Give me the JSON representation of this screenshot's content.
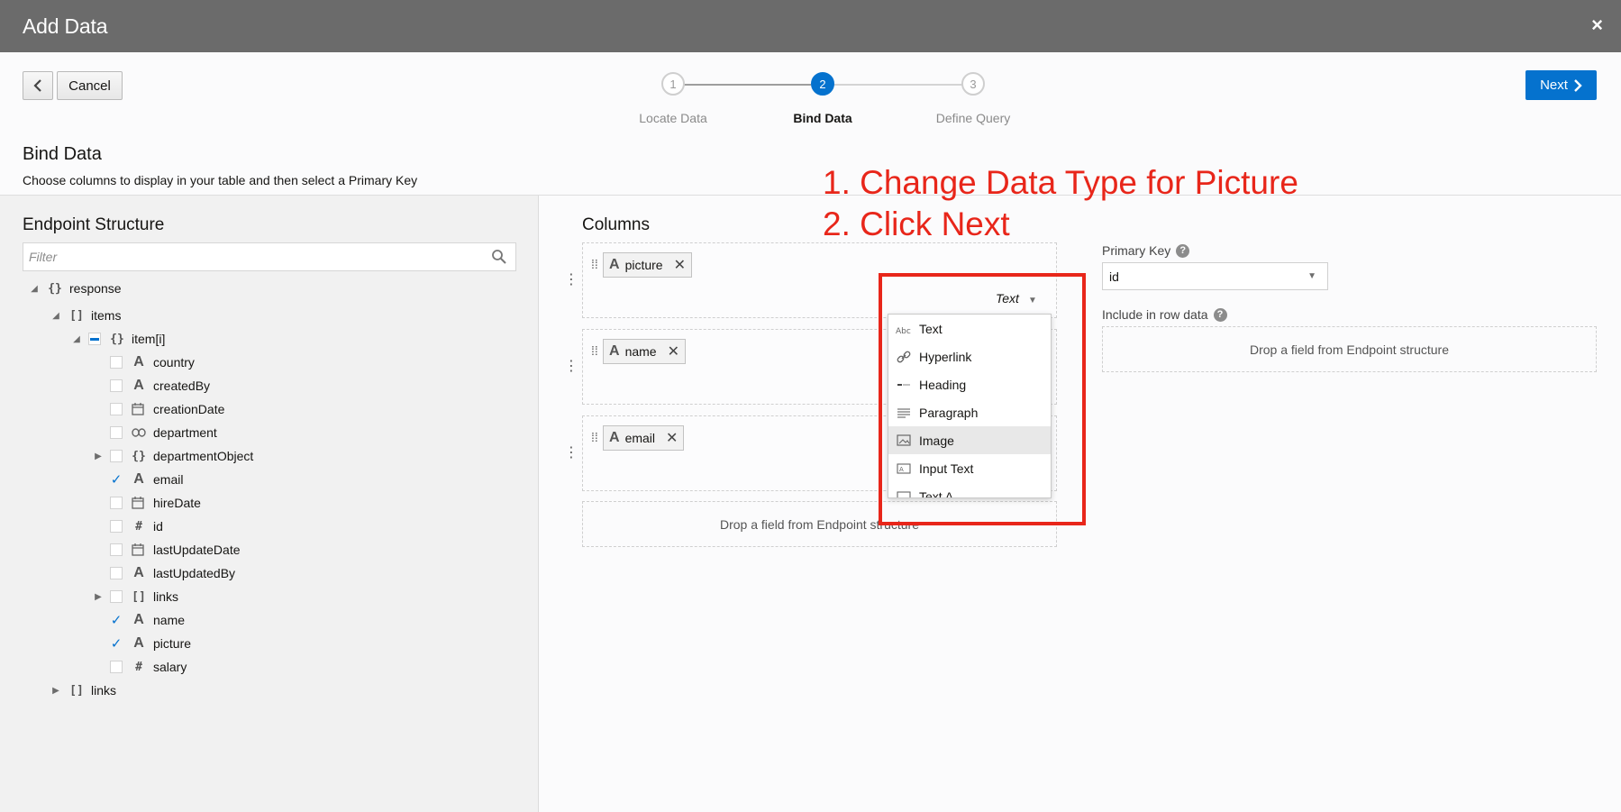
{
  "dialog": {
    "title": "Add Data",
    "close": "×"
  },
  "toolbar": {
    "back": "‹",
    "cancel": "Cancel",
    "next": "Next"
  },
  "stepper": {
    "steps": [
      {
        "num": "1",
        "label": "Locate Data"
      },
      {
        "num": "2",
        "label": "Bind Data"
      },
      {
        "num": "3",
        "label": "Define Query"
      }
    ]
  },
  "section": {
    "title": "Bind Data",
    "subtitle": "Choose columns to display in your table and then select a Primary Key"
  },
  "endpoint": {
    "title": "Endpoint Structure",
    "filter_placeholder": "Filter",
    "tree": {
      "response": "response",
      "items": "items",
      "item": "item[i]",
      "fields": [
        "country",
        "createdBy",
        "creationDate",
        "department",
        "departmentObject",
        "email",
        "hireDate",
        "id",
        "lastUpdateDate",
        "lastUpdatedBy",
        "links",
        "name",
        "picture",
        "salary"
      ],
      "root_links": "links"
    }
  },
  "columns": {
    "title": "Columns",
    "chips": [
      "picture",
      "name",
      "email"
    ],
    "drop_text": "Drop a field from Endpoint structure",
    "type_value": "Text"
  },
  "type_menu": {
    "items": [
      "Text",
      "Hyperlink",
      "Heading",
      "Paragraph",
      "Image",
      "Input Text",
      "Text A"
    ],
    "selected": "Image"
  },
  "annotation": {
    "line1": "1. Change Data Type for Picture",
    "line2": "2. Click Next",
    "color": "#e8261a"
  },
  "primary_key": {
    "label": "Primary Key",
    "value": "id"
  },
  "row_data": {
    "label": "Include in row data",
    "drop_text": "Drop a field from Endpoint structure"
  },
  "colors": {
    "accent": "#0572ce",
    "titlebar": "#6b6b6b"
  }
}
